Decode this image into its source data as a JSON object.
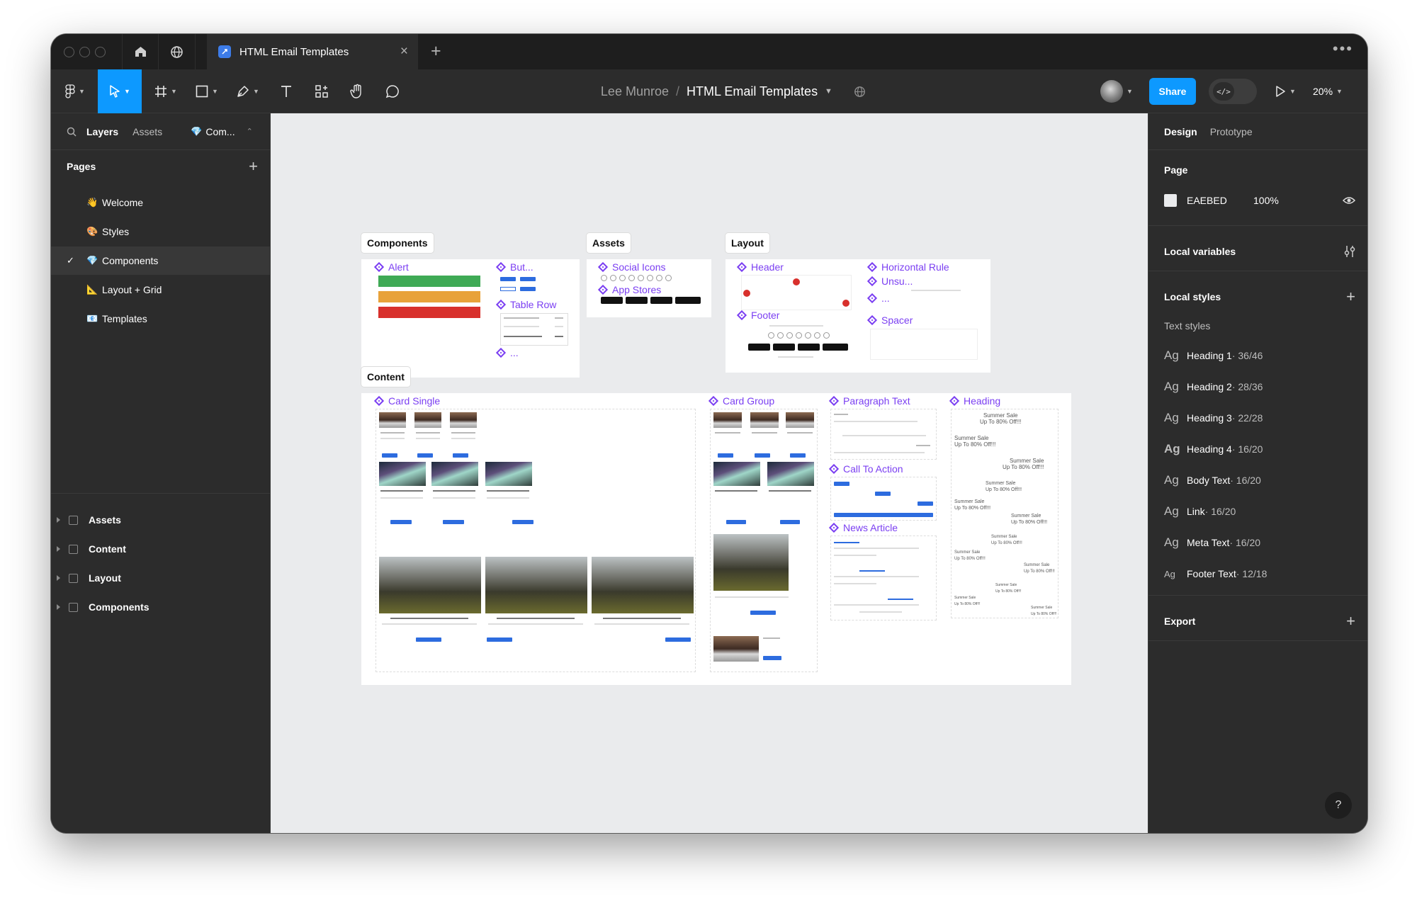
{
  "window": {
    "tab_title": "HTML Email Templates",
    "owner": "Lee Munroe",
    "separator": "/",
    "file_name": "HTML Email Templates",
    "share_label": "Share",
    "zoom": "20%"
  },
  "left_panel": {
    "tabs": [
      "Layers",
      "Assets",
      "Com..."
    ],
    "pages_title": "Pages",
    "pages": [
      {
        "emoji": "👋",
        "label": "Welcome",
        "selected": false
      },
      {
        "emoji": "🎨",
        "label": "Styles",
        "selected": false
      },
      {
        "emoji": "💎",
        "label": "Components",
        "selected": true
      },
      {
        "emoji": "📐",
        "label": "Layout + Grid",
        "selected": false
      },
      {
        "emoji": "📧",
        "label": "Templates",
        "selected": false
      }
    ],
    "layers": [
      "Assets",
      "Content",
      "Layout",
      "Components"
    ]
  },
  "right_panel": {
    "tabs": [
      "Design",
      "Prototype"
    ],
    "page_title": "Page",
    "page_color": "EAEBED",
    "page_opacity": "100%",
    "local_variables": "Local variables",
    "local_styles": "Local styles",
    "text_styles_title": "Text styles",
    "text_styles": [
      {
        "ag": "Ag",
        "name": "Heading 1",
        "meta": " · 36/46"
      },
      {
        "ag": "Ag",
        "name": "Heading 2",
        "meta": " · 28/36"
      },
      {
        "ag": "Ag",
        "name": "Heading 3",
        "meta": " · 22/28"
      },
      {
        "ag": "Ag",
        "name": "Heading 4",
        "meta": " · 16/20"
      },
      {
        "ag": "Ag",
        "name": "Body Text",
        "meta": " · 16/20"
      },
      {
        "ag": "Ag",
        "name": "Link",
        "meta": " · 16/20"
      },
      {
        "ag": "Ag",
        "name": "Meta Text",
        "meta": " · 16/20"
      },
      {
        "ag": "Ag",
        "name": "Footer Text",
        "meta": " · 12/18"
      }
    ],
    "export": "Export",
    "help": "?"
  },
  "canvas": {
    "background": "#EAEBED",
    "frames": {
      "components": "Components",
      "assets": "Assets",
      "layout": "Layout",
      "content": "Content"
    },
    "components_items": {
      "alert": "Alert",
      "buttons": "But...",
      "table_row": "Table Row",
      "more": "..."
    },
    "assets_items": {
      "social_icons": "Social Icons",
      "app_stores": "App Stores"
    },
    "layout_items": {
      "header": "Header",
      "footer": "Footer",
      "horizontal_rule": "Horizontal Rule",
      "unsubscribe": "Unsu...",
      "more": "...",
      "spacer": "Spacer"
    },
    "content_items": {
      "card_single": "Card Single",
      "card_group": "Card Group",
      "paragraph_text": "Paragraph Text",
      "call_to_action": "Call To Action",
      "news_article": "News Article",
      "heading": "Heading"
    },
    "sale_heading": "Summer Sale",
    "sale_text": "Up To 80% Off!!!"
  },
  "colors": {
    "accent": "#0D99FF",
    "component_purple": "#7B3FF2",
    "alert_green": "#3FAA55",
    "alert_orange": "#E8A23A",
    "alert_red": "#D8302C",
    "email_button_blue": "#2D6CDF"
  }
}
